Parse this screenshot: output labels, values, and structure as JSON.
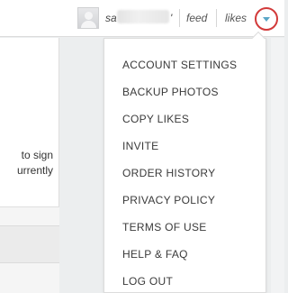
{
  "header": {
    "username_prefix": "sa",
    "username_suffix": "'",
    "nav": [
      "feed",
      "likes"
    ]
  },
  "background": {
    "text_lines": [
      "to sign",
      "urrently"
    ]
  },
  "menu": {
    "items": [
      "ACCOUNT SETTINGS",
      "BACKUP PHOTOS",
      "COPY LIKES",
      "INVITE",
      "ORDER HISTORY",
      "PRIVACY POLICY",
      "TERMS OF USE",
      "HELP & FAQ",
      "LOG OUT"
    ]
  },
  "colors": {
    "accent_circle": "#d23a3a",
    "caret_icon": "#5aa7c7"
  }
}
